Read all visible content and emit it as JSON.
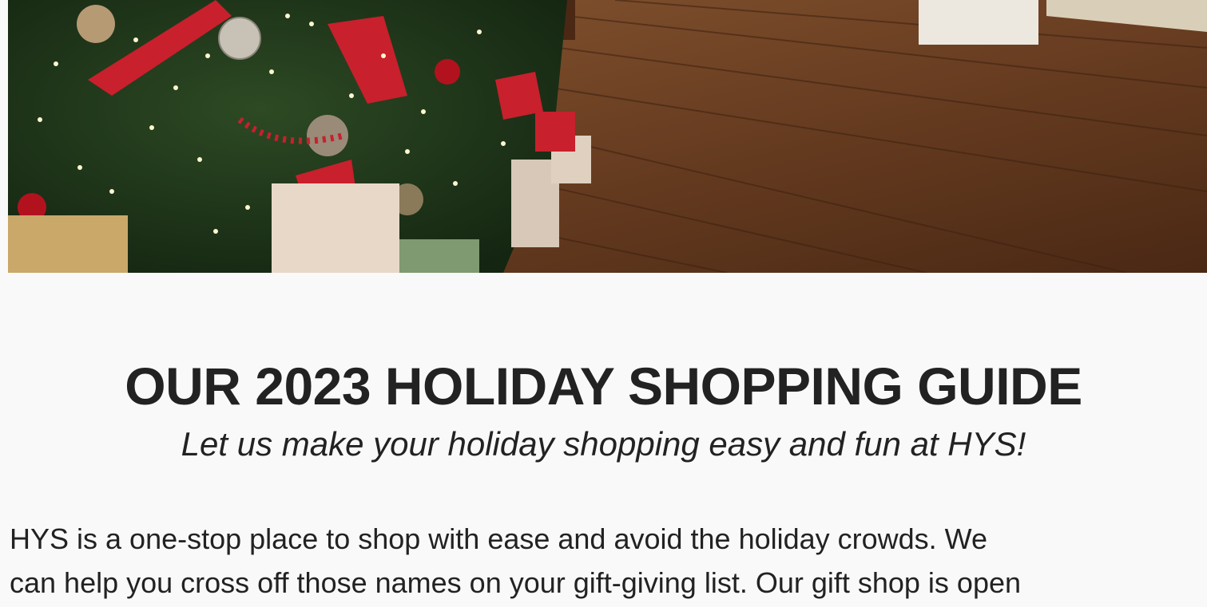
{
  "hero": {
    "alt_subject": "christmas-tree-with-gifts-on-wood-floor"
  },
  "guide": {
    "title": "OUR 2023 HOLIDAY SHOPPING GUIDE",
    "subtitle": "Let us make your holiday shopping easy and fun at HYS!",
    "body": "HYS is a one-stop place to shop with ease and avoid the holiday crowds. We\ncan help you cross off those names on your gift-giving list. Our gift shop is open"
  },
  "colors": {
    "background": "#f9f9f9",
    "text": "#222222",
    "floor": "#6b3f22",
    "tree": "#1f3a1c",
    "ribbon": "#c8202c"
  }
}
